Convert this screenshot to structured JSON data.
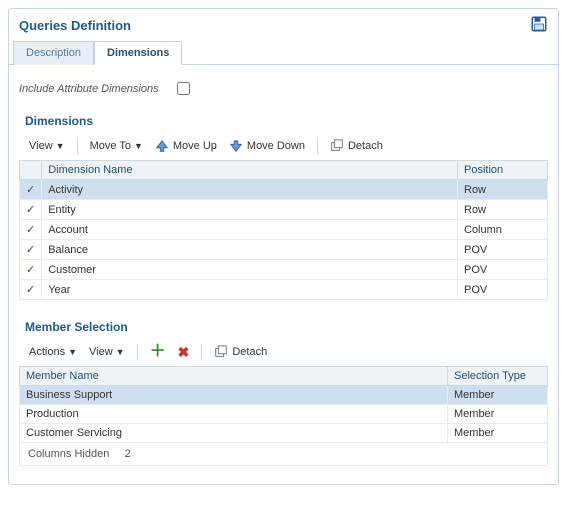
{
  "panelTitle": "Queries Definition",
  "tabs": {
    "inactive": "Description",
    "active": "Dimensions"
  },
  "includeAttr": {
    "label": "Include Attribute Dimensions",
    "checked": false
  },
  "dimSection": {
    "title": "Dimensions",
    "toolbar": {
      "view": "View",
      "moveTo": "Move To",
      "moveUp": "Move Up",
      "moveDown": "Move Down",
      "detach": "Detach"
    },
    "cols": {
      "name": "Dimension Name",
      "pos": "Position"
    },
    "rows": [
      {
        "name": "Activity",
        "pos": "Row",
        "selected": true
      },
      {
        "name": "Entity",
        "pos": "Row",
        "selected": false
      },
      {
        "name": "Account",
        "pos": "Column",
        "selected": false
      },
      {
        "name": "Balance",
        "pos": "POV",
        "selected": false
      },
      {
        "name": "Customer",
        "pos": "POV",
        "selected": false
      },
      {
        "name": "Year",
        "pos": "POV",
        "selected": false
      }
    ]
  },
  "memberSection": {
    "title": "Member Selection",
    "toolbar": {
      "actions": "Actions",
      "view": "View",
      "detach": "Detach"
    },
    "cols": {
      "name": "Member Name",
      "sel": "Selection Type"
    },
    "rows": [
      {
        "name": "Business Support",
        "sel": "Member",
        "selected": true
      },
      {
        "name": "Production",
        "sel": "Member",
        "selected": false
      },
      {
        "name": "Customer Servicing",
        "sel": "Member",
        "selected": false
      }
    ],
    "hiddenLabel": "Columns Hidden",
    "hiddenCount": "2"
  }
}
